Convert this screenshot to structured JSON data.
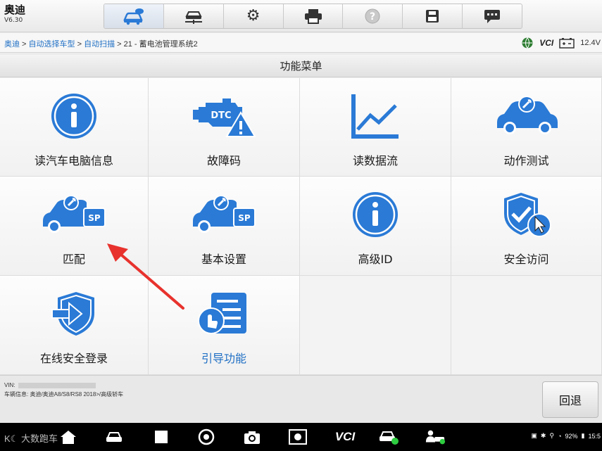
{
  "app": {
    "title": "奥迪",
    "version": "V6.30"
  },
  "toolbar": {
    "buttons": [
      {
        "name": "vehicle-home",
        "icon": "car-cloud-icon"
      },
      {
        "name": "vehicle-lift",
        "icon": "car-lift-icon"
      },
      {
        "name": "settings",
        "icon": "gear-icon"
      },
      {
        "name": "print",
        "icon": "printer-icon"
      },
      {
        "name": "help",
        "icon": "help-icon"
      },
      {
        "name": "save",
        "icon": "save-icon"
      },
      {
        "name": "message",
        "icon": "message-icon"
      }
    ]
  },
  "breadcrumb": {
    "items": [
      "奥迪",
      "自动选择车型",
      "自动扫描"
    ],
    "separator": " > ",
    "current": "21 - 蓄电池管理系统2"
  },
  "status": {
    "vci": "VCI",
    "voltage": "12.4V"
  },
  "menu": {
    "title": "功能菜单",
    "tiles": [
      {
        "label": "读汽车电脑信息",
        "icon": "info-icon"
      },
      {
        "label": "故障码",
        "icon": "dtc-engine-icon"
      },
      {
        "label": "读数据流",
        "icon": "line-chart-icon"
      },
      {
        "label": "动作测试",
        "icon": "car-wrench-icon"
      },
      {
        "label": "匹配",
        "icon": "car-sp-icon"
      },
      {
        "label": "基本设置",
        "icon": "car-sp-icon"
      },
      {
        "label": "高级ID",
        "icon": "info-icon"
      },
      {
        "label": "安全访问",
        "icon": "shield-check-icon"
      },
      {
        "label": "在线安全登录",
        "icon": "shield-login-icon"
      },
      {
        "label": "引导功能",
        "icon": "guided-doc-icon"
      }
    ]
  },
  "footer": {
    "vin_label": "VIN:",
    "vehicle_info": "车辆信息: 奥迪/奥迪A8/S8/RS8 2018>/高级轿车",
    "back_label": "回退"
  },
  "navbar": {
    "watermark": "大数跑车",
    "battery": "92%",
    "time": "15:5"
  },
  "colors": {
    "accent_blue": "#1f6fc4",
    "icon_blue": "#2a7ad6",
    "arrow_red": "#e8322d"
  }
}
